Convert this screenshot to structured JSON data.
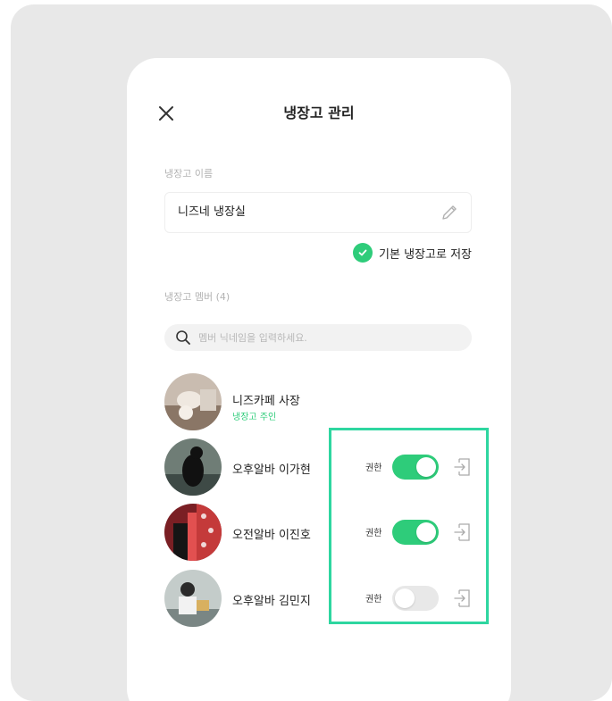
{
  "header": {
    "title": "냉장고 관리"
  },
  "fridge_name": {
    "label": "냉장고 이름",
    "value": "니즈네 냉장실"
  },
  "default_save": {
    "label": "기본 냉장고로 저장",
    "checked": true
  },
  "members": {
    "label": "냉장고 멤버 (4)",
    "search_placeholder": "멤버 닉네임을 입력하세요.",
    "list": [
      {
        "name": "니즈카페 사장",
        "role": "냉장고 주인",
        "avatar_color": "#b8a89a"
      },
      {
        "name": "오후알바 이가현",
        "permission_label": "권한",
        "permission_on": true,
        "avatar_color": "#4a5a55"
      },
      {
        "name": "오전알바 이진호",
        "permission_label": "권한",
        "permission_on": true,
        "avatar_color": "#a03030"
      },
      {
        "name": "오후알바 김민지",
        "permission_label": "권한",
        "permission_on": false,
        "avatar_color": "#8a9a98"
      }
    ]
  },
  "colors": {
    "accent": "#2ecc7a",
    "highlight": "#2ed6a0"
  }
}
